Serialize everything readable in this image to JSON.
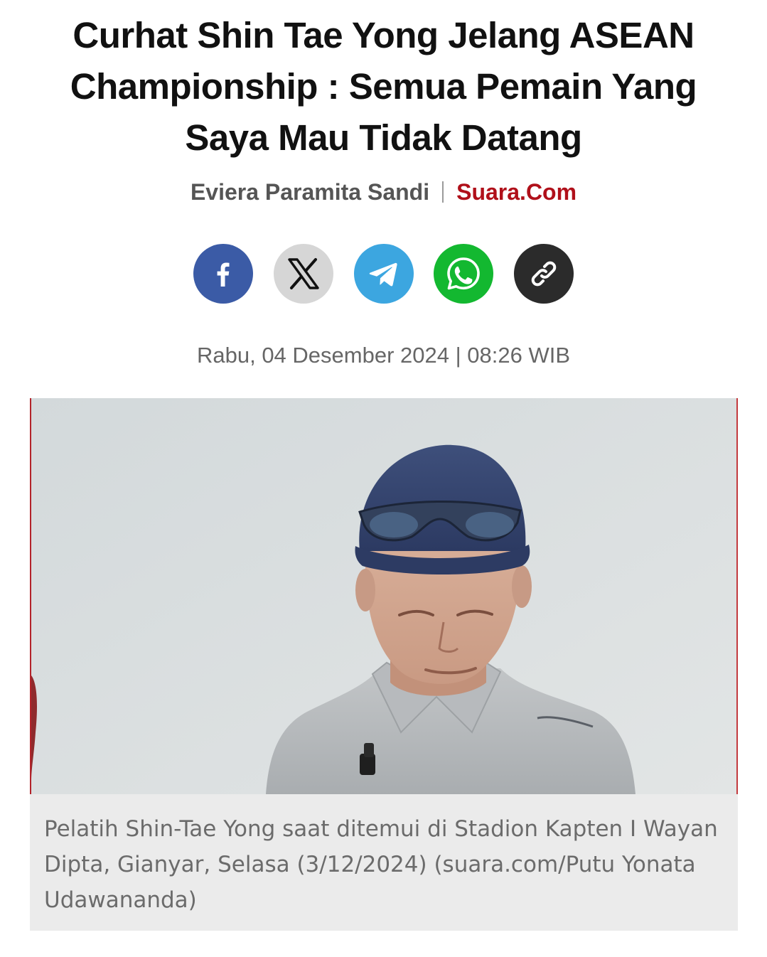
{
  "article": {
    "title": "Curhat Shin Tae Yong Jelang ASEAN Championship : Semua Pemain Yang Saya Mau Tidak Datang",
    "author": "Eviera Paramita Sandi",
    "source": "Suara.Com",
    "date": "Rabu, 04 Desember 2024 | 08:26 WIB",
    "caption": "Pelatih Shin-Tae Yong saat ditemui di Stadion Kapten I Wayan Dipta, Gianyar, Selasa (3/12/2024) (suara.com/Putu Yonata Udawananda)"
  },
  "share": [
    {
      "name": "facebook",
      "icon": "facebook-icon",
      "color": "#3b5ba6"
    },
    {
      "name": "x",
      "icon": "x-icon",
      "color": "#d6d6d6"
    },
    {
      "name": "telegram",
      "icon": "telegram-icon",
      "color": "#3ca6e0"
    },
    {
      "name": "whatsapp",
      "icon": "whatsapp-icon",
      "color": "#13b830"
    },
    {
      "name": "copy-link",
      "icon": "link-icon",
      "color": "#2b2b2b"
    }
  ],
  "colors": {
    "title": "#111111",
    "author": "#555555",
    "source": "#b0101a",
    "date": "#666666",
    "caption_bg": "#ebebeb",
    "caption_text": "#6b6b6b"
  }
}
